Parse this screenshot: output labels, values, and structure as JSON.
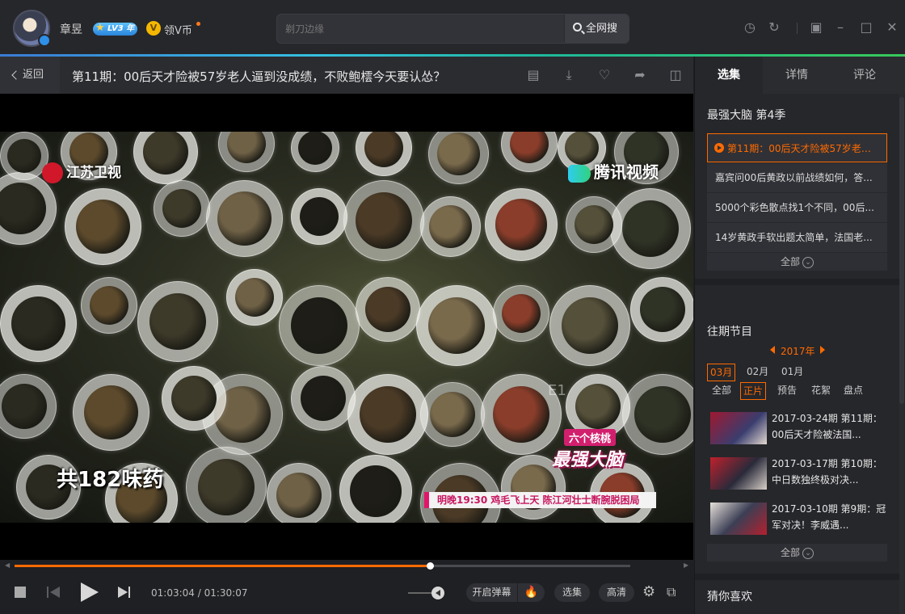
{
  "user": {
    "name": "章昱",
    "level_badge": "LV3 年",
    "vcoin_label": "领V币",
    "vcoin_icon": "V"
  },
  "search": {
    "placeholder": "剃刀边缘",
    "button_label": "全网搜"
  },
  "window_controls": [
    "history-icon",
    "refresh-icon",
    "mini-player-icon",
    "minimize-icon",
    "maximize-icon",
    "close-icon"
  ],
  "titlebar": {
    "back_label": "返回",
    "episode_title": "第11期：00后天才险被57岁老人逼到没成绩，不败鲍橒今天要认怂？",
    "actions": [
      "screenshot-icon",
      "download-icon",
      "favorite-add-icon",
      "share-icon",
      "cast-icon"
    ]
  },
  "video": {
    "channel_logo": "江苏卫视",
    "platform_logo": "腾讯视频",
    "caption": "共182味药",
    "show_tag": "六个核桃",
    "show_logo": "最强大脑",
    "ticker": "明晚19:30 鸡毛飞上天 陈江河壮士断腕脱困局",
    "overlay_text": "E1"
  },
  "player": {
    "progress": 0.675,
    "current_time": "01:03:04",
    "total_time": "01:30:07",
    "volume": 0.7,
    "danmu_label": "开启弹幕",
    "episodes_label": "选集",
    "quality_label": "高清"
  },
  "sidebar": {
    "tabs": [
      "选集",
      "详情",
      "评论"
    ],
    "active_tab": 0,
    "series_title": "最强大脑 第4季",
    "episodes": [
      "第11期：00后天才险被57岁老人...",
      "嘉宾问00后黄政以前战绩如何，答...",
      "5000个彩色散点找1个不同，00后...",
      "14岁黄政手软出题太简单，法国老..."
    ],
    "more_label": "全部",
    "past_title": "往期节目",
    "year": "2017年",
    "months": [
      "03月",
      "02月",
      "01月"
    ],
    "filters": [
      "全部",
      "正片",
      "预告",
      "花絮",
      "盘点"
    ],
    "past_items": [
      {
        "line1": "2017-03-24期 第11期：",
        "line2": "00后天才险被法国..."
      },
      {
        "line1": "2017-03-17期 第10期：",
        "line2": "中日数独终极对决..."
      },
      {
        "line1": "2017-03-10期 第9期：冠",
        "line2": "军对决！李威遇..."
      }
    ],
    "more_label_2": "全部",
    "guess_title": "猜你喜欢"
  }
}
